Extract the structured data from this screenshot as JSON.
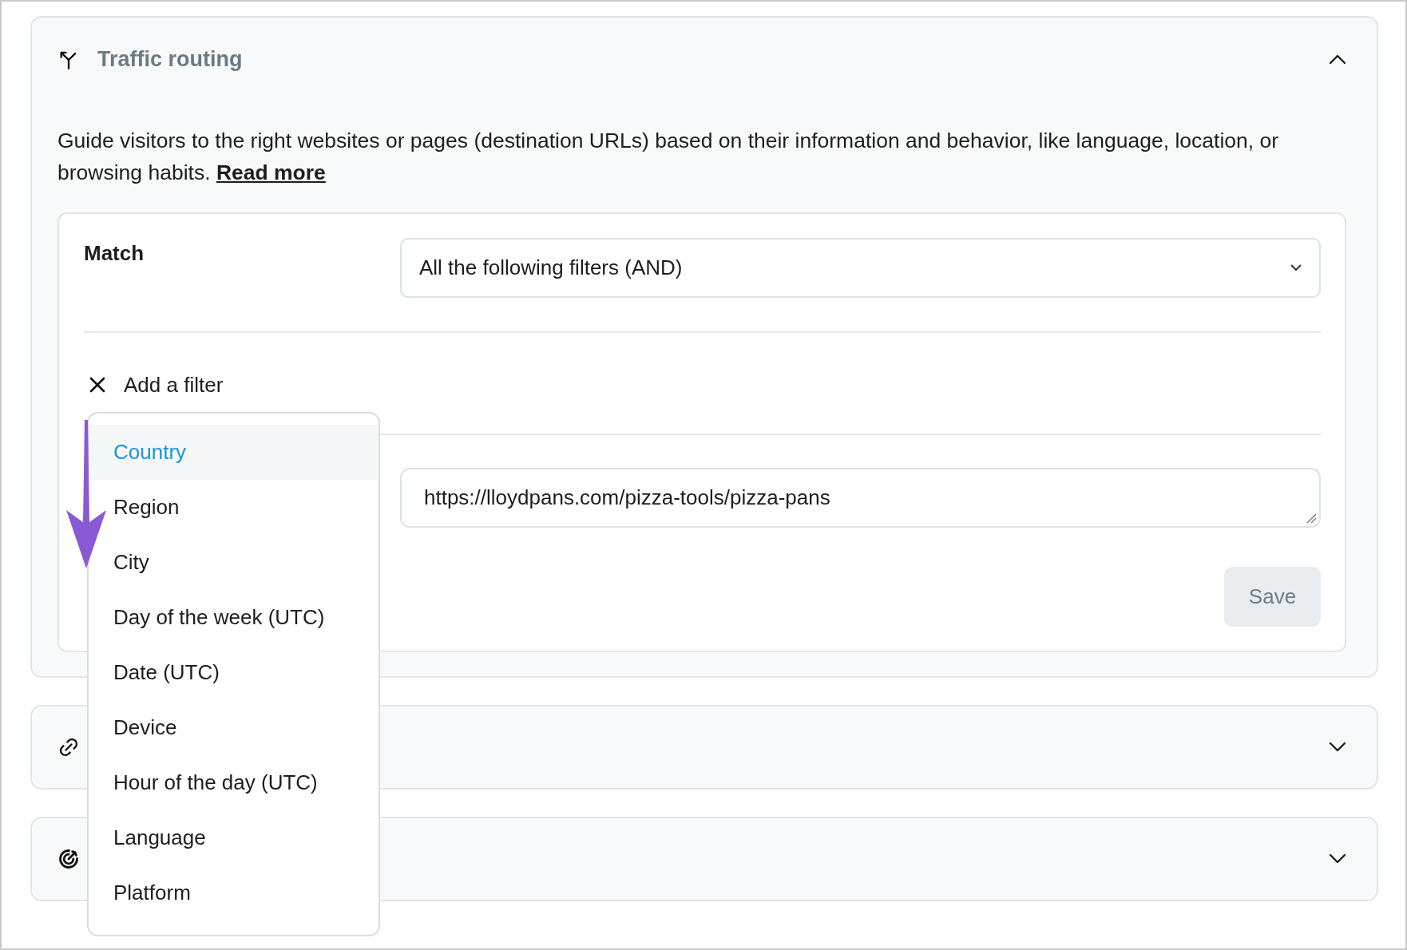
{
  "sections": [
    {
      "kind": "routing",
      "title": "Traffic routing",
      "expanded": true
    },
    {
      "kind": "link",
      "expanded": false
    },
    {
      "kind": "target",
      "expanded": false
    }
  ],
  "routing": {
    "description": "Guide visitors to the right websites or pages (destination URLs) based on their information and behavior, like language, location, or browsing habits.",
    "read_more": "Read more",
    "match_label": "Match",
    "match_value": "All the following filters (AND)",
    "add_filter": "Add a filter",
    "url": "https://lloydpans.com/pizza-tools/pizza-pans",
    "save": {
      "label": "Save",
      "disabled": true
    }
  },
  "filter_menu": [
    {
      "label": "Country",
      "selected": true
    },
    {
      "label": "Region",
      "selected": false
    },
    {
      "label": "City",
      "selected": false
    },
    {
      "label": "Day of the week (UTC)",
      "selected": false
    },
    {
      "label": "Date (UTC)",
      "selected": false
    },
    {
      "label": "Device",
      "selected": false
    },
    {
      "label": "Hour of the day (UTC)",
      "selected": false
    },
    {
      "label": "Language",
      "selected": false
    },
    {
      "label": "Platform",
      "selected": false
    }
  ]
}
